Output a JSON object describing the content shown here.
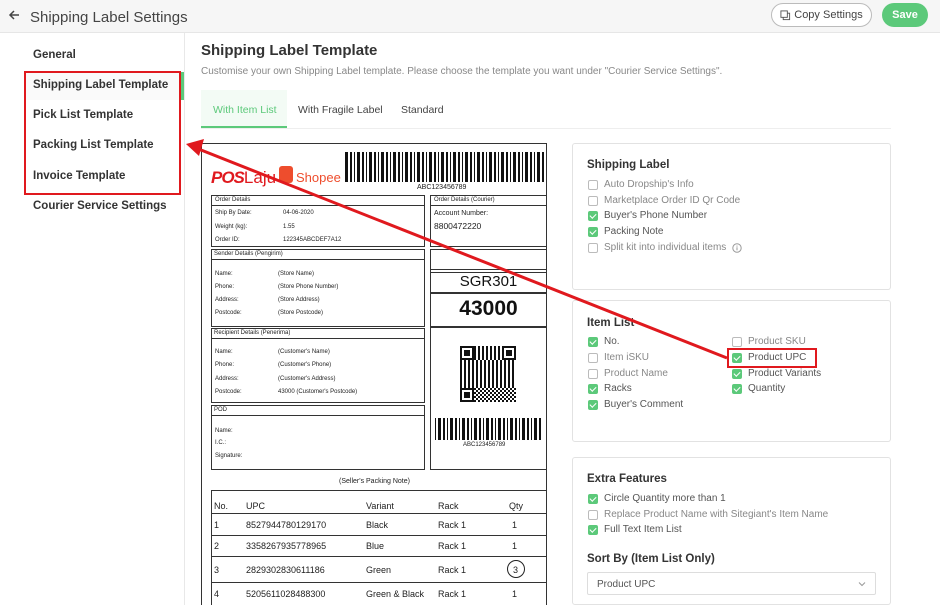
{
  "header": {
    "title": "Shipping Label Settings",
    "copy_label": "Copy Settings",
    "save_label": "Save"
  },
  "sidebar": {
    "items": [
      {
        "label": "General"
      },
      {
        "label": "Shipping Label Template"
      },
      {
        "label": "Pick List Template"
      },
      {
        "label": "Packing List Template"
      },
      {
        "label": "Invoice Template"
      },
      {
        "label": "Courier Service Settings"
      }
    ],
    "active_index": 1
  },
  "main": {
    "title": "Shipping Label Template",
    "subtitle": "Customise your own Shipping Label template. Please choose the template you want under \"Courier Service Settings\".",
    "tabs": [
      {
        "label": "With Item List"
      },
      {
        "label": "With Fragile Label"
      },
      {
        "label": "Standard"
      }
    ],
    "active_tab": 0
  },
  "label_preview": {
    "brand_left": "POS",
    "brand_mid": "Laju",
    "brand_right": "Shopee",
    "barcode_text": "ABC123456789",
    "order_details_title": "Order Details",
    "order_rows": [
      {
        "k": "Ship By Date:",
        "v": "04-06-2020"
      },
      {
        "k": "Weight (kg):",
        "v": "1.55"
      },
      {
        "k": "Order ID:",
        "v": "122345ABCDEF7A12"
      }
    ],
    "courier_title": "Order Details (Courier)",
    "account_label": "Account Number:",
    "account_value": "8800472220",
    "sender_title": "Sender Details (Pengirim)",
    "sender_rows": [
      {
        "k": "Name:",
        "v": "(Store Name)"
      },
      {
        "k": "Phone:",
        "v": "(Store Phone Number)"
      },
      {
        "k": "Address:",
        "v": "(Store Address)"
      },
      {
        "k": "Postcode:",
        "v": "(Store Postcode)"
      }
    ],
    "recipient_title": "Recipient Details (Penerima)",
    "recipient_rows": [
      {
        "k": "Name:",
        "v": "(Customer's Name)"
      },
      {
        "k": "Phone:",
        "v": "(Customer's Phone)"
      },
      {
        "k": "Address:",
        "v": "(Customer's Address)"
      },
      {
        "k": "Postcode:",
        "v": "43000 (Customer's Postcode)"
      }
    ],
    "route_code": "SGR301",
    "postcode": "43000",
    "pod_title": "POD",
    "pod_rows": [
      "Name:",
      "I.C.:",
      "Signature:"
    ],
    "packing_note": "(Seller's Packing Note)",
    "table_headers": [
      "No.",
      "UPC",
      "Variant",
      "Rack",
      "Qty"
    ],
    "table_rows": [
      {
        "no": "1",
        "upc": "8527944780129170",
        "variant": "Black",
        "rack": "Rack 1",
        "qty": "1"
      },
      {
        "no": "2",
        "upc": "3358267935778965",
        "variant": "Blue",
        "rack": "Rack 1",
        "qty": "1"
      },
      {
        "no": "3",
        "upc": "2829302830611186",
        "variant": "Green",
        "rack": "Rack 1",
        "qty": "3"
      },
      {
        "no": "4",
        "upc": "5205611028488300",
        "variant": "Green & Black",
        "rack": "Rack 1",
        "qty": "1"
      }
    ]
  },
  "shipping_label_card": {
    "title": "Shipping Label",
    "options": [
      {
        "label": "Auto Dropship's Info",
        "checked": false
      },
      {
        "label": "Marketplace Order ID Qr Code",
        "checked": false
      },
      {
        "label": "Buyer's Phone Number",
        "checked": true
      },
      {
        "label": "Packing Note",
        "checked": true
      },
      {
        "label": "Split kit into individual items",
        "checked": false
      }
    ]
  },
  "item_list_card": {
    "title": "Item List",
    "left_options": [
      {
        "label": "No.",
        "checked": true
      },
      {
        "label": "Item iSKU",
        "checked": false
      },
      {
        "label": "Product Name",
        "checked": false
      },
      {
        "label": "Racks",
        "checked": true
      },
      {
        "label": "Buyer's Comment",
        "checked": true
      }
    ],
    "right_options": [
      {
        "label": "Product SKU",
        "checked": false
      },
      {
        "label": "Product UPC",
        "checked": true
      },
      {
        "label": "Product Variants",
        "checked": true
      },
      {
        "label": "Quantity",
        "checked": true
      }
    ]
  },
  "extra_card": {
    "title": "Extra Features",
    "options": [
      {
        "label": "Circle Quantity more than 1",
        "checked": true
      },
      {
        "label": "Replace Product Name with Sitegiant's Item Name",
        "checked": false
      },
      {
        "label": "Full Text Item List",
        "checked": true
      }
    ],
    "sort_label": "Sort By (Item List Only)",
    "sort_value": "Product UPC"
  },
  "colors": {
    "accent": "#5cc97a",
    "annotation": "#e0191e",
    "pos_red": "#e0191e",
    "shopee": "#ee4d2d"
  }
}
